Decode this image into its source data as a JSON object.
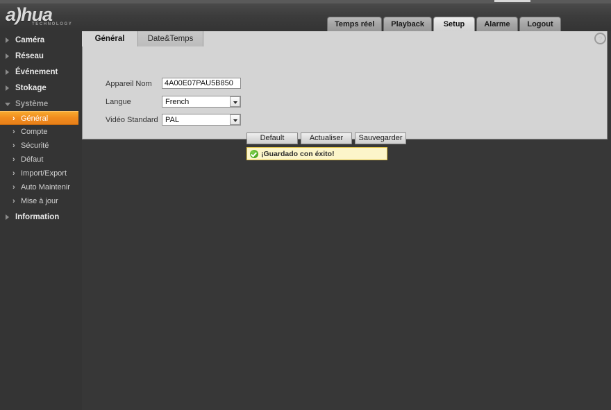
{
  "window": {
    "strip": "title-bar"
  },
  "header": {
    "logo_word": "a)hua",
    "logo_tagline": "TECHNOLOGY",
    "nav": [
      {
        "label": "Temps réel",
        "active": false
      },
      {
        "label": "Playback",
        "active": false
      },
      {
        "label": "Setup",
        "active": true
      },
      {
        "label": "Alarme",
        "active": false
      },
      {
        "label": "Logout",
        "active": false
      }
    ]
  },
  "sidebar": {
    "items": [
      {
        "label": "Caméra",
        "level": 0,
        "expanded": false,
        "selected": false
      },
      {
        "label": "Réseau",
        "level": 0,
        "expanded": false,
        "selected": false
      },
      {
        "label": "Événement",
        "level": 0,
        "expanded": false,
        "selected": false
      },
      {
        "label": "Stokage",
        "level": 0,
        "expanded": false,
        "selected": false
      },
      {
        "label": "Système",
        "level": 0,
        "expanded": true,
        "selected": false
      },
      {
        "label": "Général",
        "level": 1,
        "expanded": false,
        "selected": true
      },
      {
        "label": "Compte",
        "level": 1,
        "expanded": false,
        "selected": false
      },
      {
        "label": "Sécurité",
        "level": 1,
        "expanded": false,
        "selected": false
      },
      {
        "label": "Défaut",
        "level": 1,
        "expanded": false,
        "selected": false
      },
      {
        "label": "Import/Export",
        "level": 1,
        "expanded": false,
        "selected": false
      },
      {
        "label": "Auto Maintenir",
        "level": 1,
        "expanded": false,
        "selected": false
      },
      {
        "label": "Mise à jour",
        "level": 1,
        "expanded": false,
        "selected": false
      },
      {
        "label": "Information",
        "level": 0,
        "expanded": false,
        "selected": false
      }
    ]
  },
  "content": {
    "tabs": [
      {
        "label": "Général",
        "active": true
      },
      {
        "label": "Date&Temps",
        "active": false
      }
    ],
    "help_icon": "?",
    "form": {
      "device_name_label": "Appareil Nom",
      "device_name_value": "4A00E07PAU5B850",
      "language_label": "Langue",
      "language_value": "French",
      "video_standard_label": "Vidéo Standard",
      "video_standard_value": "PAL"
    },
    "buttons": [
      {
        "label": "Default"
      },
      {
        "label": "Actualiser"
      },
      {
        "label": "Sauvegarder"
      }
    ],
    "message": {
      "icon": "check-circle-icon",
      "text": "¡Guardado con éxito!",
      "background": "#fcf5ca",
      "border": "#e0c243"
    }
  },
  "colors": {
    "accent": "#f08b1d",
    "page_bg": "#373737",
    "panel_bg": "#d4d4d4"
  }
}
